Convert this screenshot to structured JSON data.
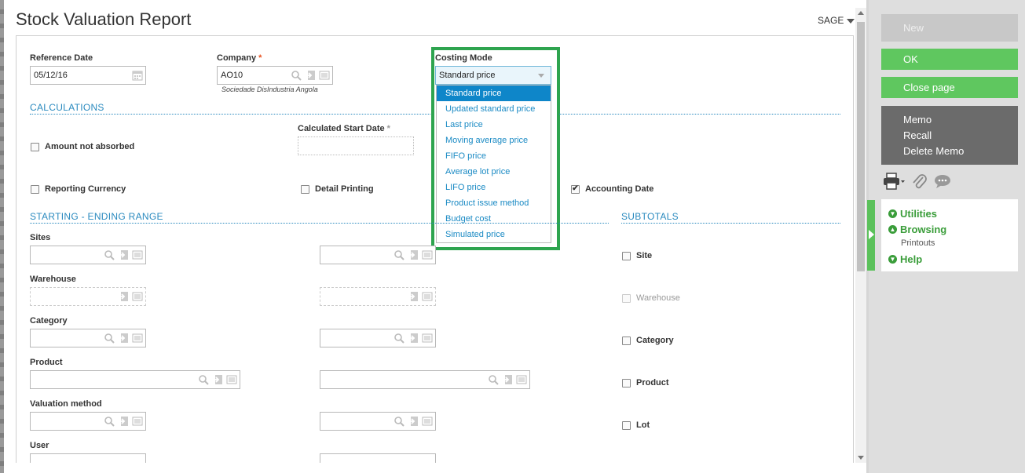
{
  "header": {
    "title": "Stock Valuation Report",
    "user": "SAGE"
  },
  "reference_date": {
    "label": "Reference Date",
    "value": "05/12/16"
  },
  "company": {
    "label": "Company",
    "value": "AO10",
    "description": "Sociedade DisIndustria Angola"
  },
  "costing_mode": {
    "label": "Costing Mode",
    "selected": "Standard price",
    "options": [
      "Standard price",
      "Updated standard price",
      "Last price",
      "Moving average price",
      "FIFO price",
      "Average lot price",
      "LIFO price",
      "Product issue method",
      "Budget cost",
      "Simulated price"
    ]
  },
  "calculations": {
    "title": "CALCULATIONS",
    "amount_not_absorbed": "Amount not absorbed",
    "calculated_start_date": "Calculated Start Date",
    "reporting_currency": "Reporting Currency",
    "detail_printing": "Detail Printing",
    "accounting_date": "Accounting Date"
  },
  "range": {
    "title": "STARTING - ENDING RANGE",
    "sites": "Sites",
    "warehouse": "Warehouse",
    "category": "Category",
    "product": "Product",
    "valuation_method": "Valuation method",
    "user": "User"
  },
  "subtotals": {
    "title": "SUBTOTALS",
    "site": "Site",
    "warehouse": "Warehouse",
    "category": "Category",
    "product": "Product",
    "lot": "Lot"
  },
  "panel": {
    "new": "New",
    "ok": "OK",
    "close_page": "Close page",
    "memo": "Memo",
    "recall": "Recall",
    "delete_memo": "Delete Memo",
    "utilities": "Utilities",
    "browsing": "Browsing",
    "printouts": "Printouts",
    "help": "Help"
  },
  "colors": {
    "accent_blue": "#2a8abf",
    "green": "#5fc75f",
    "highlight": "#2ea44f",
    "selected": "#0e86c9"
  }
}
